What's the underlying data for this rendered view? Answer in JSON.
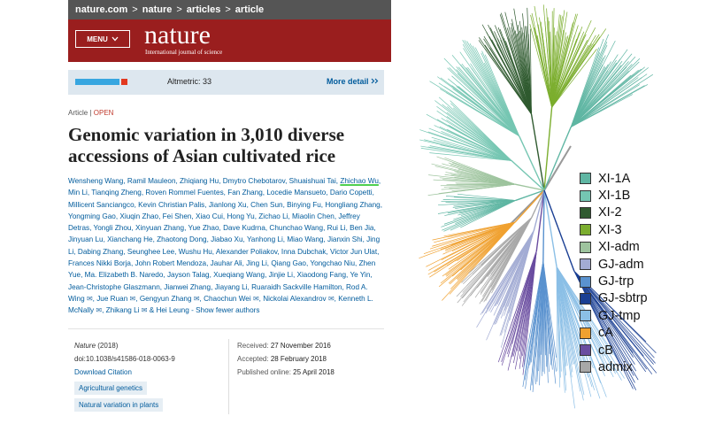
{
  "browser": {
    "crumbs": [
      "nature.com",
      "nature",
      "articles",
      "article"
    ],
    "separator": ">"
  },
  "header": {
    "menu_label": "MENU",
    "logo": "nature",
    "logo_subtitle": "International journal of science"
  },
  "altmetric": {
    "label": "Altmetric: 33",
    "more_label": "More detail",
    "more_icon": "double-chevron-right-icon"
  },
  "article": {
    "type": "Article",
    "separator": "|",
    "access": "OPEN",
    "title": "Genomic variation in 3,010 diverse accessions of Asian cultivated rice",
    "authors_part1": "Wensheng Wang, Ramil Mauleon, Zhiqiang Hu, Dmytro Chebotarov, Shuaishuai Tai, ",
    "highlighted_author": "Zhichao Wu",
    "authors_part2": ", Min Li, Tianqing Zheng, Roven Rommel Fuentes, Fan Zhang, Locedie Mansueto, Dario Copetti, Millicent Sanciangco, Kevin Christian Palis, Jianlong Xu, Chen Sun, Binying Fu, Hongliang Zhang, Yongming Gao, Xiuqin Zhao, Fei Shen, Xiao Cui, Hong Yu, Zichao Li, Miaolin Chen, Jeffrey Detras, Yongli Zhou, Xinyuan Zhang, Yue Zhao, Dave Kudrna, Chunchao Wang, Rui Li, Ben Jia, Jinyuan Lu, Xianchang He, Zhaotong Dong, Jiabao Xu, Yanhong Li, Miao Wang, Jianxin Shi, Jing Li, Dabing Zhang, Seunghee Lee, Wushu Hu, Alexander Poliakov, Inna Dubchak, Victor Jun Ulat, Frances Nikki Borja, John Robert Mendoza, Jauhar Ali, Jing Li, Qiang Gao, Yongchao Niu, Zhen Yue, Ma. Elizabeth B. Naredo, Jayson Talag, Xueqiang Wang, Jinjie Li, Xiaodong Fang, Ye Yin, Jean-Christophe Glaszmann, Jianwei Zhang, Jiayang Li, Ruaraidh Sackville Hamilton, Rod A. Wing",
    "corr_author_1": "Jue Ruan",
    "corr_author_2": "Gengyun Zhang",
    "corr_author_3": "Chaochun Wei",
    "corr_author_4": "Nickolai Alexandrov",
    "corr_author_5": "Kenneth L. McNally",
    "corr_author_6": "Zhikang Li",
    "last_author_join": "& Hei Leung",
    "show_fewer": "- Show fewer authors",
    "mail_icon": "envelope-icon"
  },
  "meta": {
    "journal": "Nature",
    "year": "(2018)",
    "doi": "doi:10.1038/s41586-018-0063-9",
    "download": "Download Citation",
    "tags": [
      "Agricultural genetics",
      "Natural variation in plants"
    ],
    "received_label": "Received:",
    "received": "27 November 2016",
    "accepted_label": "Accepted:",
    "accepted": "28 February 2018",
    "published_label": "Published online:",
    "published": "25 April 2018"
  },
  "tree": {
    "legend": [
      {
        "label": "XI-1A",
        "color": "#5fb6a3"
      },
      {
        "label": "XI-1B",
        "color": "#75c6b2"
      },
      {
        "label": "XI-2",
        "color": "#2f5a2f"
      },
      {
        "label": "XI-3",
        "color": "#7cae2f"
      },
      {
        "label": "XI-adm",
        "color": "#9ec49e"
      },
      {
        "label": "GJ-adm",
        "color": "#a3acd4"
      },
      {
        "label": "GJ-trp",
        "color": "#5a92cf"
      },
      {
        "label": "GJ-sbtrp",
        "color": "#1a3f93"
      },
      {
        "label": "GJ-tmp",
        "color": "#8bbfe6"
      },
      {
        "label": "cA",
        "color": "#f0a130"
      },
      {
        "label": "cB",
        "color": "#6a4da0"
      },
      {
        "label": "admix",
        "color": "#a8a8a8"
      }
    ]
  }
}
